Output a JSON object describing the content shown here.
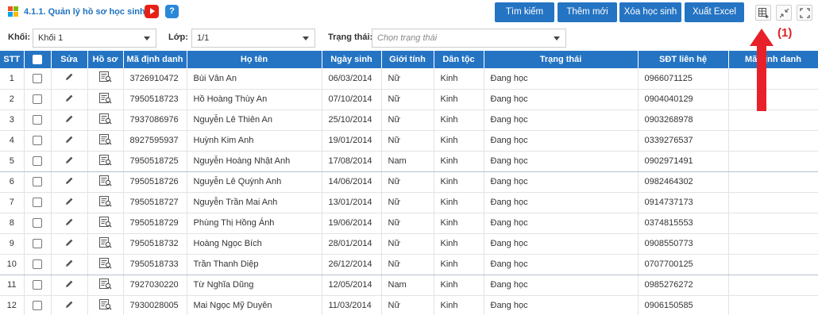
{
  "header": {
    "title": "4.1.1. Quản lý hồ sơ học sinh",
    "help_label": "?",
    "buttons": {
      "search": "Tìm kiếm",
      "add": "Thêm mới",
      "delete": "Xóa học sinh",
      "export": "Xuất Excel"
    }
  },
  "filters": {
    "khoi_label": "Khối:",
    "khoi_value": "Khối 1",
    "lop_label": "Lớp:",
    "lop_value": "1/1",
    "status_label": "Trạng thái:",
    "status_placeholder": "Chọn trạng thái"
  },
  "annotation": "(1)",
  "colors": {
    "primary": "#2574c3",
    "annotation": "#e02020"
  },
  "table": {
    "columns": [
      "STT",
      "",
      "Sửa",
      "Hồ sơ",
      "Mã định danh",
      "Họ tên",
      "Ngày sinh",
      "Giới tính",
      "Dân tộc",
      "Trạng thái",
      "SĐT liên hệ",
      "Mã định danh"
    ],
    "rows": [
      {
        "stt": "1",
        "id": "3726910472",
        "name": "Bùi Vân An",
        "dob": "06/03/2014",
        "gender": "Nữ",
        "ethnic": "Kinh",
        "status": "Đang học",
        "phone": "0966071125"
      },
      {
        "stt": "2",
        "id": "7950518723",
        "name": "Hồ Hoàng Thùy An",
        "dob": "07/10/2014",
        "gender": "Nữ",
        "ethnic": "Kinh",
        "status": "Đang học",
        "phone": "0904040129"
      },
      {
        "stt": "3",
        "id": "7937086976",
        "name": "Nguyễn Lê Thiên An",
        "dob": "25/10/2014",
        "gender": "Nữ",
        "ethnic": "Kinh",
        "status": "Đang học",
        "phone": "0903268978"
      },
      {
        "stt": "4",
        "id": "8927595937",
        "name": "Huỳnh Kim Anh",
        "dob": "19/01/2014",
        "gender": "Nữ",
        "ethnic": "Kinh",
        "status": "Đang học",
        "phone": "0339276537"
      },
      {
        "stt": "5",
        "id": "7950518725",
        "name": "Nguyễn Hoàng Nhật Anh",
        "dob": "17/08/2014",
        "gender": "Nam",
        "ethnic": "Kinh",
        "status": "Đang học",
        "phone": "0902971491"
      },
      {
        "stt": "6",
        "id": "7950518726",
        "name": "Nguyễn Lê Quỳnh Anh",
        "dob": "14/06/2014",
        "gender": "Nữ",
        "ethnic": "Kinh",
        "status": "Đang học",
        "phone": "0982464302"
      },
      {
        "stt": "7",
        "id": "7950518727",
        "name": "Nguyễn Trần Mai Anh",
        "dob": "13/01/2014",
        "gender": "Nữ",
        "ethnic": "Kinh",
        "status": "Đang học",
        "phone": "0914737173"
      },
      {
        "stt": "8",
        "id": "7950518729",
        "name": "Phùng Thị Hồng Ánh",
        "dob": "19/06/2014",
        "gender": "Nữ",
        "ethnic": "Kinh",
        "status": "Đang học",
        "phone": "0374815553"
      },
      {
        "stt": "9",
        "id": "7950518732",
        "name": "Hoàng Ngọc Bích",
        "dob": "28/01/2014",
        "gender": "Nữ",
        "ethnic": "Kinh",
        "status": "Đang học",
        "phone": "0908550773"
      },
      {
        "stt": "10",
        "id": "7950518733",
        "name": "Trần Thanh Diệp",
        "dob": "26/12/2014",
        "gender": "Nữ",
        "ethnic": "Kinh",
        "status": "Đang học",
        "phone": "0707700125"
      },
      {
        "stt": "11",
        "id": "7927030220",
        "name": "Từ Nghĩa Dũng",
        "dob": "12/05/2014",
        "gender": "Nam",
        "ethnic": "Kinh",
        "status": "Đang học",
        "phone": "0985276272"
      },
      {
        "stt": "12",
        "id": "7930028005",
        "name": "Mai Ngọc Mỹ Duyên",
        "dob": "11/03/2014",
        "gender": "Nữ",
        "ethnic": "Kinh",
        "status": "Đang học",
        "phone": "0906150585"
      }
    ]
  }
}
